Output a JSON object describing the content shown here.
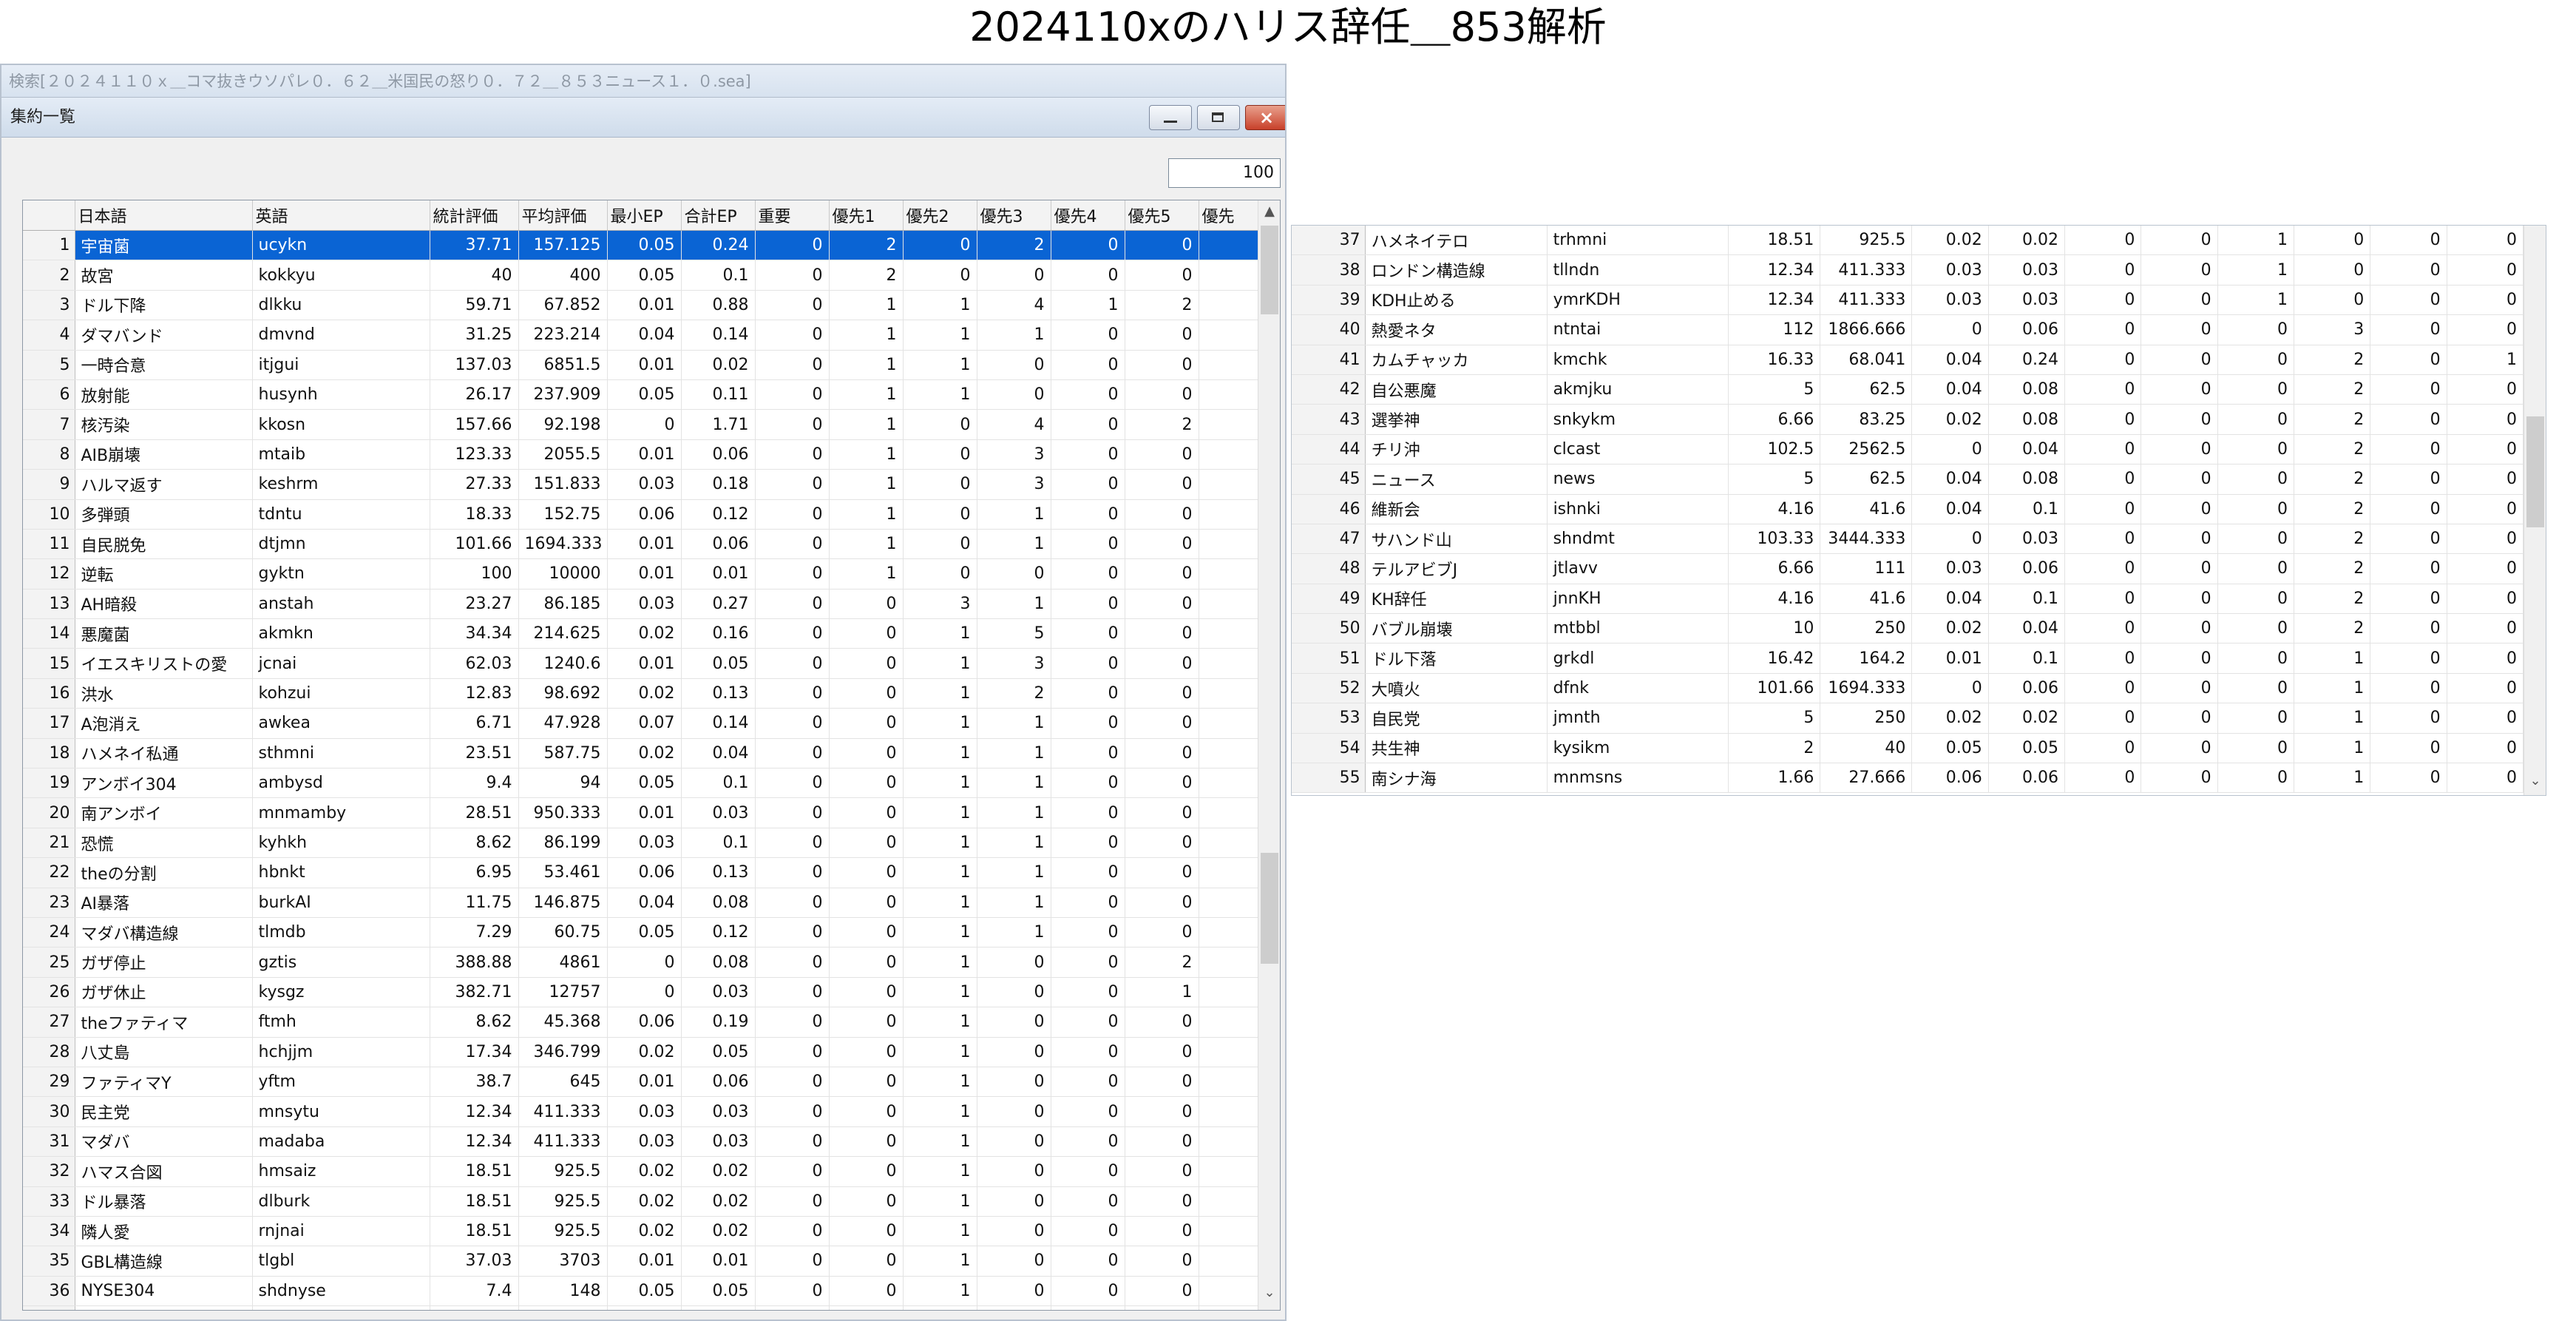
{
  "page_title": "2024110xのハリス辞任＿853解析",
  "search_bar": "検索[２０２４１１０ｘ＿コマ抜きウソパレ０．６２＿米国民の怒り０．７２＿８５３ニュース１．０.sea]",
  "window": {
    "title": "集約一覧",
    "close_glyph": "×",
    "count_value": "100"
  },
  "table": {
    "columns": [
      "日本語",
      "英語",
      "統計評価",
      "平均評価",
      "最小EP",
      "合計EP",
      "重要",
      "優先1",
      "優先2",
      "優先3",
      "優先4",
      "優先5",
      "優先"
    ],
    "rows": [
      [
        "1",
        "宇宙菌",
        "ucykn",
        "37.71",
        "157.125",
        "0.05",
        "0.24",
        "0",
        "2",
        "0",
        "2",
        "0",
        "0"
      ],
      [
        "2",
        "故宮",
        "kokkyu",
        "40",
        "400",
        "0.05",
        "0.1",
        "0",
        "2",
        "0",
        "0",
        "0",
        "0"
      ],
      [
        "3",
        "ドル下降",
        "dlkku",
        "59.71",
        "67.852",
        "0.01",
        "0.88",
        "0",
        "1",
        "1",
        "4",
        "1",
        "2"
      ],
      [
        "4",
        "ダマバンド",
        "dmvnd",
        "31.25",
        "223.214",
        "0.04",
        "0.14",
        "0",
        "1",
        "1",
        "1",
        "0",
        "0"
      ],
      [
        "5",
        "一時合意",
        "itjgui",
        "137.03",
        "6851.5",
        "0.01",
        "0.02",
        "0",
        "1",
        "1",
        "0",
        "0",
        "0"
      ],
      [
        "6",
        "放射能",
        "husynh",
        "26.17",
        "237.909",
        "0.05",
        "0.11",
        "0",
        "1",
        "1",
        "0",
        "0",
        "0"
      ],
      [
        "7",
        "核汚染",
        "kkosn",
        "157.66",
        "92.198",
        "0",
        "1.71",
        "0",
        "1",
        "0",
        "4",
        "0",
        "2"
      ],
      [
        "8",
        "AIB崩壊",
        "mtaib",
        "123.33",
        "2055.5",
        "0.01",
        "0.06",
        "0",
        "1",
        "0",
        "3",
        "0",
        "0"
      ],
      [
        "9",
        "ハルマ返す",
        "keshrm",
        "27.33",
        "151.833",
        "0.03",
        "0.18",
        "0",
        "1",
        "0",
        "3",
        "0",
        "0"
      ],
      [
        "10",
        "多弾頭",
        "tdntu",
        "18.33",
        "152.75",
        "0.06",
        "0.12",
        "0",
        "1",
        "0",
        "1",
        "0",
        "0"
      ],
      [
        "11",
        "自民脱免",
        "dtjmn",
        "101.66",
        "1694.333",
        "0.01",
        "0.06",
        "0",
        "1",
        "0",
        "1",
        "0",
        "0"
      ],
      [
        "12",
        "逆転",
        "gyktn",
        "100",
        "10000",
        "0.01",
        "0.01",
        "0",
        "1",
        "0",
        "0",
        "0",
        "0"
      ],
      [
        "13",
        "AH暗殺",
        "anstah",
        "23.27",
        "86.185",
        "0.03",
        "0.27",
        "0",
        "0",
        "3",
        "1",
        "0",
        "0"
      ],
      [
        "14",
        "悪魔菌",
        "akmkn",
        "34.34",
        "214.625",
        "0.02",
        "0.16",
        "0",
        "0",
        "1",
        "5",
        "0",
        "0"
      ],
      [
        "15",
        "イエスキリストの愛",
        "jcnai",
        "62.03",
        "1240.6",
        "0.01",
        "0.05",
        "0",
        "0",
        "1",
        "3",
        "0",
        "0"
      ],
      [
        "16",
        "洪水",
        "kohzui",
        "12.83",
        "98.692",
        "0.02",
        "0.13",
        "0",
        "0",
        "1",
        "2",
        "0",
        "0"
      ],
      [
        "17",
        "A泡消え",
        "awkea",
        "6.71",
        "47.928",
        "0.07",
        "0.14",
        "0",
        "0",
        "1",
        "1",
        "0",
        "0"
      ],
      [
        "18",
        "ハメネイ私通",
        "sthmni",
        "23.51",
        "587.75",
        "0.02",
        "0.04",
        "0",
        "0",
        "1",
        "1",
        "0",
        "0"
      ],
      [
        "19",
        "アンボイ304",
        "ambysd",
        "9.4",
        "94",
        "0.05",
        "0.1",
        "0",
        "0",
        "1",
        "1",
        "0",
        "0"
      ],
      [
        "20",
        "南アンボイ",
        "mnmamby",
        "28.51",
        "950.333",
        "0.01",
        "0.03",
        "0",
        "0",
        "1",
        "1",
        "0",
        "0"
      ],
      [
        "21",
        "恐慌",
        "kyhkh",
        "8.62",
        "86.199",
        "0.03",
        "0.1",
        "0",
        "0",
        "1",
        "1",
        "0",
        "0"
      ],
      [
        "22",
        "theの分割",
        "hbnkt",
        "6.95",
        "53.461",
        "0.06",
        "0.13",
        "0",
        "0",
        "1",
        "1",
        "0",
        "0"
      ],
      [
        "23",
        "AI暴落",
        "burkAI",
        "11.75",
        "146.875",
        "0.04",
        "0.08",
        "0",
        "0",
        "1",
        "1",
        "0",
        "0"
      ],
      [
        "24",
        "マダバ構造線",
        "tlmdb",
        "7.29",
        "60.75",
        "0.05",
        "0.12",
        "0",
        "0",
        "1",
        "1",
        "0",
        "0"
      ],
      [
        "25",
        "ガザ停止",
        "gztis",
        "388.88",
        "4861",
        "0",
        "0.08",
        "0",
        "0",
        "1",
        "0",
        "0",
        "2"
      ],
      [
        "26",
        "ガザ休止",
        "kysgz",
        "382.71",
        "12757",
        "0",
        "0.03",
        "0",
        "0",
        "1",
        "0",
        "0",
        "1"
      ],
      [
        "27",
        "theファティマ",
        "ftmh",
        "8.62",
        "45.368",
        "0.06",
        "0.19",
        "0",
        "0",
        "1",
        "0",
        "0",
        "0"
      ],
      [
        "28",
        "八丈島",
        "hchjjm",
        "17.34",
        "346.799",
        "0.02",
        "0.05",
        "0",
        "0",
        "1",
        "0",
        "0",
        "0"
      ],
      [
        "29",
        "ファティマY",
        "yftm",
        "38.7",
        "645",
        "0.01",
        "0.06",
        "0",
        "0",
        "1",
        "0",
        "0",
        "0"
      ],
      [
        "30",
        "民主党",
        "mnsytu",
        "12.34",
        "411.333",
        "0.03",
        "0.03",
        "0",
        "0",
        "1",
        "0",
        "0",
        "0"
      ],
      [
        "31",
        "マダバ",
        "madaba",
        "12.34",
        "411.333",
        "0.03",
        "0.03",
        "0",
        "0",
        "1",
        "0",
        "0",
        "0"
      ],
      [
        "32",
        "ハマス合図",
        "hmsaiz",
        "18.51",
        "925.5",
        "0.02",
        "0.02",
        "0",
        "0",
        "1",
        "0",
        "0",
        "0"
      ],
      [
        "33",
        "ドル暴落",
        "dlburk",
        "18.51",
        "925.5",
        "0.02",
        "0.02",
        "0",
        "0",
        "1",
        "0",
        "0",
        "0"
      ],
      [
        "34",
        "隣人愛",
        "rnjnai",
        "18.51",
        "925.5",
        "0.02",
        "0.02",
        "0",
        "0",
        "1",
        "0",
        "0",
        "0"
      ],
      [
        "35",
        "GBL構造線",
        "tlgbl",
        "37.03",
        "3703",
        "0.01",
        "0.01",
        "0",
        "0",
        "1",
        "0",
        "0",
        "0"
      ],
      [
        "36",
        "NYSE304",
        "shdnyse",
        "7.4",
        "148",
        "0.05",
        "0.05",
        "0",
        "0",
        "1",
        "0",
        "0",
        "0"
      ],
      [
        "37",
        "ハメネイテロ",
        "trhmni",
        "18.51",
        "925.5",
        "0.02",
        "0.02",
        "0",
        "0",
        "1",
        "0",
        "0",
        "0"
      ]
    ],
    "right_rows": [
      [
        "37",
        "ハメネイテロ",
        "trhmni",
        "18.51",
        "925.5",
        "0.02",
        "0.02",
        "0",
        "0",
        "1",
        "0",
        "0",
        "0"
      ],
      [
        "38",
        "ロンドン構造線",
        "tllndn",
        "12.34",
        "411.333",
        "0.03",
        "0.03",
        "0",
        "0",
        "1",
        "0",
        "0",
        "0"
      ],
      [
        "39",
        "KDH止める",
        "ymrKDH",
        "12.34",
        "411.333",
        "0.03",
        "0.03",
        "0",
        "0",
        "1",
        "0",
        "0",
        "0"
      ],
      [
        "40",
        "熱愛ネタ",
        "ntntai",
        "112",
        "1866.666",
        "0",
        "0.06",
        "0",
        "0",
        "0",
        "3",
        "0",
        "0"
      ],
      [
        "41",
        "カムチャッカ",
        "kmchk",
        "16.33",
        "68.041",
        "0.04",
        "0.24",
        "0",
        "0",
        "0",
        "2",
        "0",
        "1"
      ],
      [
        "42",
        "自公悪魔",
        "akmjku",
        "5",
        "62.5",
        "0.04",
        "0.08",
        "0",
        "0",
        "0",
        "2",
        "0",
        "0"
      ],
      [
        "43",
        "選挙神",
        "snkykm",
        "6.66",
        "83.25",
        "0.02",
        "0.08",
        "0",
        "0",
        "0",
        "2",
        "0",
        "0"
      ],
      [
        "44",
        "チリ沖",
        "clcast",
        "102.5",
        "2562.5",
        "0",
        "0.04",
        "0",
        "0",
        "0",
        "2",
        "0",
        "0"
      ],
      [
        "45",
        "ニュース",
        "news",
        "5",
        "62.5",
        "0.04",
        "0.08",
        "0",
        "0",
        "0",
        "2",
        "0",
        "0"
      ],
      [
        "46",
        "維新会",
        "ishnki",
        "4.16",
        "41.6",
        "0.04",
        "0.1",
        "0",
        "0",
        "0",
        "2",
        "0",
        "0"
      ],
      [
        "47",
        "サハンド山",
        "shndmt",
        "103.33",
        "3444.333",
        "0",
        "0.03",
        "0",
        "0",
        "0",
        "2",
        "0",
        "0"
      ],
      [
        "48",
        "テルアビブJ",
        "jtlavv",
        "6.66",
        "111",
        "0.03",
        "0.06",
        "0",
        "0",
        "0",
        "2",
        "0",
        "0"
      ],
      [
        "49",
        "KH辞任",
        "jnnKH",
        "4.16",
        "41.6",
        "0.04",
        "0.1",
        "0",
        "0",
        "0",
        "2",
        "0",
        "0"
      ],
      [
        "50",
        "バブル崩壊",
        "mtbbl",
        "10",
        "250",
        "0.02",
        "0.04",
        "0",
        "0",
        "0",
        "2",
        "0",
        "0"
      ],
      [
        "51",
        "ドル下落",
        "grkdl",
        "16.42",
        "164.2",
        "0.01",
        "0.1",
        "0",
        "0",
        "0",
        "1",
        "0",
        "0"
      ],
      [
        "52",
        "大噴火",
        "dfnk",
        "101.66",
        "1694.333",
        "0",
        "0.06",
        "0",
        "0",
        "0",
        "1",
        "0",
        "0"
      ],
      [
        "53",
        "自民党",
        "jmnth",
        "5",
        "250",
        "0.02",
        "0.02",
        "0",
        "0",
        "0",
        "1",
        "0",
        "0"
      ],
      [
        "54",
        "共生神",
        "kysikm",
        "2",
        "40",
        "0.05",
        "0.05",
        "0",
        "0",
        "0",
        "1",
        "0",
        "0"
      ],
      [
        "55",
        "南シナ海",
        "mnmsns",
        "1.66",
        "27.666",
        "0.06",
        "0.06",
        "0",
        "0",
        "0",
        "1",
        "0",
        "0"
      ]
    ]
  },
  "scroll": {
    "up": "▲",
    "down": "⌄"
  }
}
